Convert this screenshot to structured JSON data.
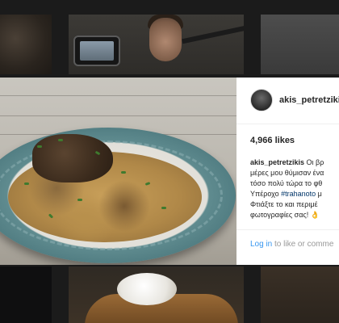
{
  "post": {
    "username": "akis_petretzikis",
    "likes": "4,966 likes",
    "caption": {
      "username": "akis_petretzikis",
      "line1": " Οι βρ",
      "line2": "μέρες μου θύμισαν ένα",
      "line3": "τόσο πολύ τώρα το φθ",
      "line4_prefix": "Υπέροχο ",
      "hashtag": "#trahanoto",
      "line4_suffix": " μ",
      "line5": "Φτιάξτε το και περιμέ",
      "line6": "φωτογραφίες σας! 👌"
    },
    "login": {
      "link": "Log in",
      "text": " to like or comme"
    }
  }
}
